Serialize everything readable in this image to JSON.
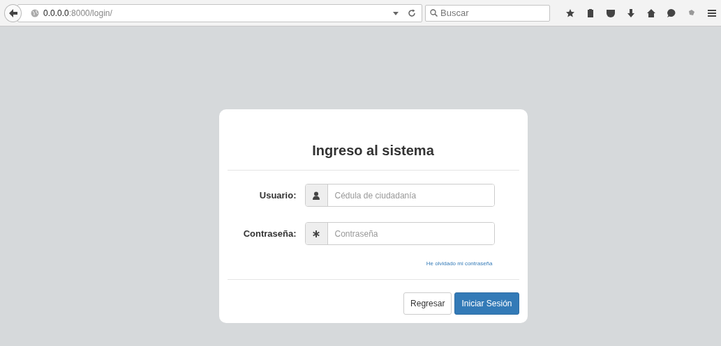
{
  "browser": {
    "url_host": "0.0.0.0",
    "url_path": ":8000/login/",
    "search_placeholder": "Buscar"
  },
  "login": {
    "title": "Ingreso al sistema",
    "fields": [
      {
        "label": "Usuario:",
        "placeholder": "Cédula de ciudadanía",
        "kind": "user"
      },
      {
        "label": "Contraseña:",
        "placeholder": "Contraseña",
        "kind": "password"
      }
    ],
    "forgot_link": "He olvidado mi contraseña",
    "buttons": [
      {
        "label": "Regresar",
        "kind": "default"
      },
      {
        "label": "Iniciar Sesión",
        "kind": "primary"
      }
    ]
  }
}
